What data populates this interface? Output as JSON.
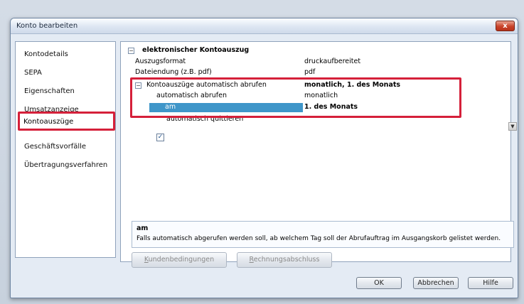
{
  "window": {
    "title": "Konto bearbeiten",
    "close_glyph": "x"
  },
  "sidebar": {
    "items": [
      {
        "label": "Kontodetails"
      },
      {
        "label": "SEPA"
      },
      {
        "label": "Eigenschaften"
      },
      {
        "label": "Umsatzanzeige"
      },
      {
        "label": "Kontoauszüge",
        "selected": true
      },
      {
        "label": "Geschäftsvorfälle"
      },
      {
        "label": "Übertragungsverfahren"
      }
    ]
  },
  "properties": {
    "section_title": "elektronischer Kontoauszug",
    "section_expander": "−",
    "rows": [
      {
        "label": "Auszugsformat",
        "value": "druckaufbereitet"
      },
      {
        "label": "Dateiendung (z.B. pdf)",
        "value": "pdf"
      }
    ],
    "auto_group": {
      "expander": "−",
      "label": "Kontoauszüge automatisch abrufen",
      "value": "monatlich, 1. des Monats",
      "children": [
        {
          "label": "automatisch abrufen",
          "value": "monatlich"
        },
        {
          "label": "am",
          "value": "1. des Monats",
          "selected": true
        }
      ]
    },
    "dropdown_glyph": "▼",
    "checkbox": {
      "label": "automatisch quittieren",
      "checked": true,
      "glyph": "✓"
    }
  },
  "description": {
    "title": "am",
    "text": "Falls automatisch abgerufen werden soll, ab welchem Tag soll der Abrufauftrag im Ausgangskorb gelistet werden."
  },
  "actions": {
    "kunden_prefix": "K",
    "kunden_rest": "undenbedingungen",
    "rechnung_prefix": "R",
    "rechnung_rest": "echnungsabschluss"
  },
  "dialog_buttons": {
    "ok": "OK",
    "cancel": "Abbrechen",
    "help": "Hilfe"
  },
  "colors": {
    "highlight_red": "#d5203a",
    "selection_blue": "#3f96c9"
  }
}
